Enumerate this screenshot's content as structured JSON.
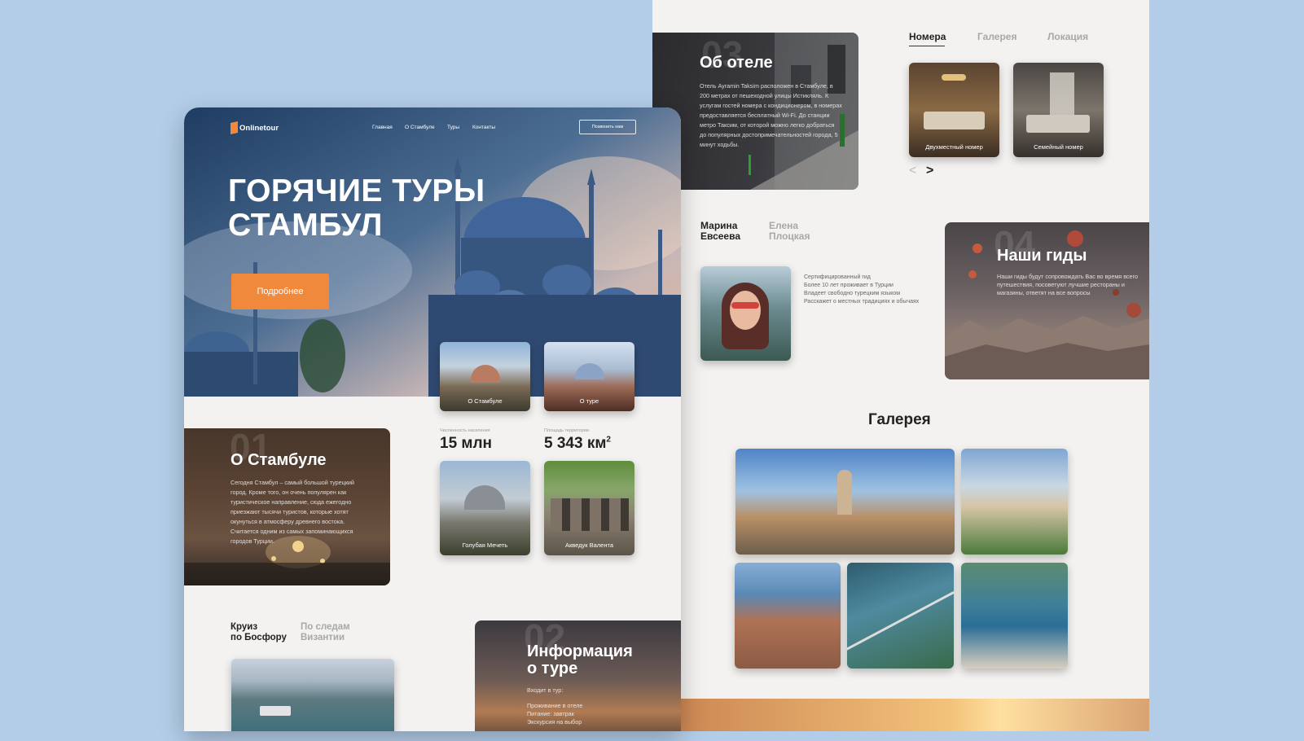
{
  "left": {
    "brand": "Onlinetour",
    "nav": [
      "Главная",
      "О Стамбуле",
      "Туры",
      "Контакты"
    ],
    "call_button": "Позвонить нам",
    "hero_title_1": "ГОРЯЧИЕ ТУРЫ",
    "hero_title_2": "СТАМБУЛ",
    "cta": "Подробнее",
    "thumb_1": "О Стамбуле",
    "thumb_2": "О туре",
    "stat_1_label": "Численность населения",
    "stat_1_value": "15 млн",
    "stat_2_label": "Площадь территории",
    "stat_2_value": "5 343 км",
    "stat_2_sup": "2",
    "about_num": "01",
    "about_title": "О Стамбуле",
    "about_text": "Сегодня Стамбул – самый большой турецкий город. Кроме того, он очень популярен как туристическое направление, сюда ежегодно приезжают тысячи туристов, которые хотят окунуться в атмосферу древнего востока. Считается одним из самых запоминающихся городов Турции.",
    "photo_1": "Голубая Мечеть",
    "photo_2": "Акведук Валента",
    "tour_tab_1_a": "Круиз",
    "tour_tab_1_b": "по Босфору",
    "tour_tab_2_a": "По следам",
    "tour_tab_2_b": "Византии",
    "info_num": "02",
    "info_title_1": "Информация",
    "info_title_2": "о туре",
    "info_sub": "Входит в тур:",
    "info_line_1": "Проживание в отеле",
    "info_line_2": "Питание: завтрак",
    "info_line_3": "Экскурсия на выбор"
  },
  "right": {
    "hotel_num": "03",
    "hotel_title": "Об отеле",
    "hotel_text": "Отель Ayramin Taksim расположен в Стамбуле, в 200 метрах от пешеходной улицы Истикляль. К услугам гостей номера с кондиционером, в номерах предоставляется бесплатный Wi-Fi. До станции метро Таксим, от которой можно легко добраться до популярных достопримечательностей города, 5 минут ходьбы.",
    "tabs": [
      "Номера",
      "Галерея",
      "Локация"
    ],
    "room_1": "Двухместный номер",
    "room_2": "Семейный номер",
    "prev": "<",
    "next": ">",
    "guide_tab_1_a": "Марина",
    "guide_tab_1_b": "Евсеева",
    "guide_tab_2_a": "Елена",
    "guide_tab_2_b": "Плоцкая",
    "guide_facts": [
      "Сертифицированный гид",
      "Более 10 лет проживает в Турции",
      "Владеет свободно турецким языком",
      "Расскажет о местных традициях и обычаях"
    ],
    "guides_num": "04",
    "guides_title": "Наши гиды",
    "guides_text": "Наши гиды будут сопровождать Вас во время всего путешествия, посоветуют лучшие рестораны и магазины, ответят на все вопросы",
    "gallery_title": "Галерея"
  },
  "colors": {
    "accent": "#f0893c",
    "background": "#b3cde8",
    "page": "#f3f2f0"
  }
}
